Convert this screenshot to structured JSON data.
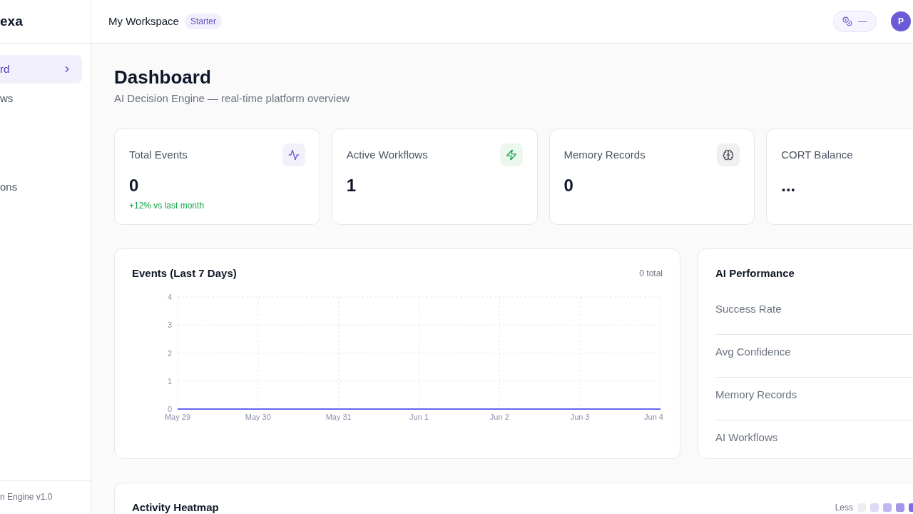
{
  "sidebar": {
    "logo": "exa",
    "nav_items": [
      {
        "label": "rd",
        "selected": true
      },
      {
        "label": "ws",
        "selected": false
      }
    ],
    "more_nav_items": [
      {
        "label": "ons",
        "selected": false
      }
    ],
    "footer": "n Engine v1.0"
  },
  "header": {
    "workspace": "My Workspace",
    "plan_badge": "Starter",
    "credits": "—",
    "avatar_initial": "P"
  },
  "page": {
    "title": "Dashboard",
    "subtitle": "AI Decision Engine — real-time platform overview"
  },
  "stat_cards": [
    {
      "label": "Total Events",
      "value": "0",
      "change": "+12% vs last month",
      "color": "#6d5fd3"
    },
    {
      "label": "Active Workflows",
      "value": "1",
      "color": "#16a34a"
    },
    {
      "label": "Memory Records",
      "value": "0",
      "color": "#52525b"
    },
    {
      "label": "CORT Balance",
      "value": "..."
    }
  ],
  "events_chart": {
    "title": "Events (Last 7 Days)",
    "total": "0 total",
    "chart_data": {
      "type": "line",
      "categories": [
        "May 29",
        "May 30",
        "May 31",
        "Jun 1",
        "Jun 2",
        "Jun 3",
        "Jun 4"
      ],
      "series": [
        {
          "color": "#6366f1",
          "values": [
            0,
            0,
            0,
            0,
            0,
            0,
            0
          ]
        }
      ],
      "ylim": [
        0,
        4
      ],
      "yticks": [
        0,
        1,
        2,
        3,
        4
      ],
      "grid": true
    }
  },
  "ai_performance": {
    "title": "AI Performance",
    "rows": [
      "Success Rate",
      "Avg Confidence",
      "Memory Records",
      "AI Workflows"
    ]
  },
  "heatmap": {
    "title": "Activity Heatmap",
    "legend": {
      "less_label": "Less",
      "swatches": [
        {
          "color": "#eeeef2"
        },
        {
          "color": "#ddd9f7"
        },
        {
          "color": "#c0b8f0"
        },
        {
          "color": "#a396e8"
        },
        {
          "color": "#7f6fdd"
        }
      ]
    }
  }
}
